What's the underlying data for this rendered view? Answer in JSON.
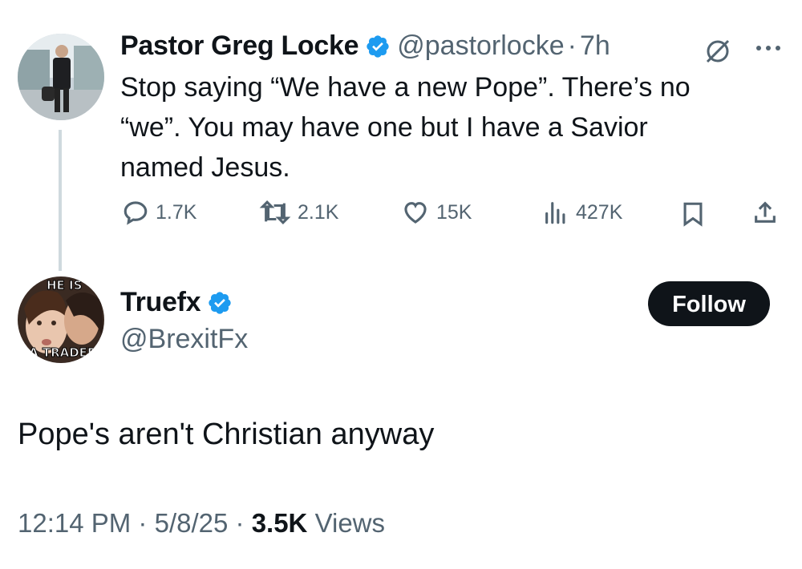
{
  "original_tweet": {
    "author_name": "Pastor Greg Locke",
    "handle": "@pastorlocke",
    "separator": "·",
    "time": "7h",
    "text_lines": [
      "Stop saying “We have a new Pope”. There’s no",
      "“we”. You may have one but I have a Savior",
      "named Jesus."
    ],
    "actions": {
      "replies": "1.7K",
      "reposts": "2.1K",
      "likes": "15K",
      "views": "427K"
    },
    "icons": [
      "grok-icon",
      "more-icon",
      "reply-icon",
      "repost-icon",
      "like-icon",
      "views-icon",
      "bookmark-icon",
      "share-icon"
    ]
  },
  "reply_tweet": {
    "author_name": "Truefx",
    "handle": "@BrexitFx",
    "follow_label": "Follow",
    "avatar_text_top": "HE IS",
    "avatar_text_bottom": "A TRADER",
    "text": "Pope's aren't Christian anyway",
    "meta": {
      "time": "12:14 PM",
      "sep1": "·",
      "date": "5/8/25",
      "sep2": "·",
      "views_count": "3.5K",
      "views_label": "Views"
    }
  },
  "colors": {
    "verified": "#1d9bf0",
    "text_primary": "#0f1419",
    "text_secondary": "#536471",
    "thread_line": "#cfd9de"
  }
}
